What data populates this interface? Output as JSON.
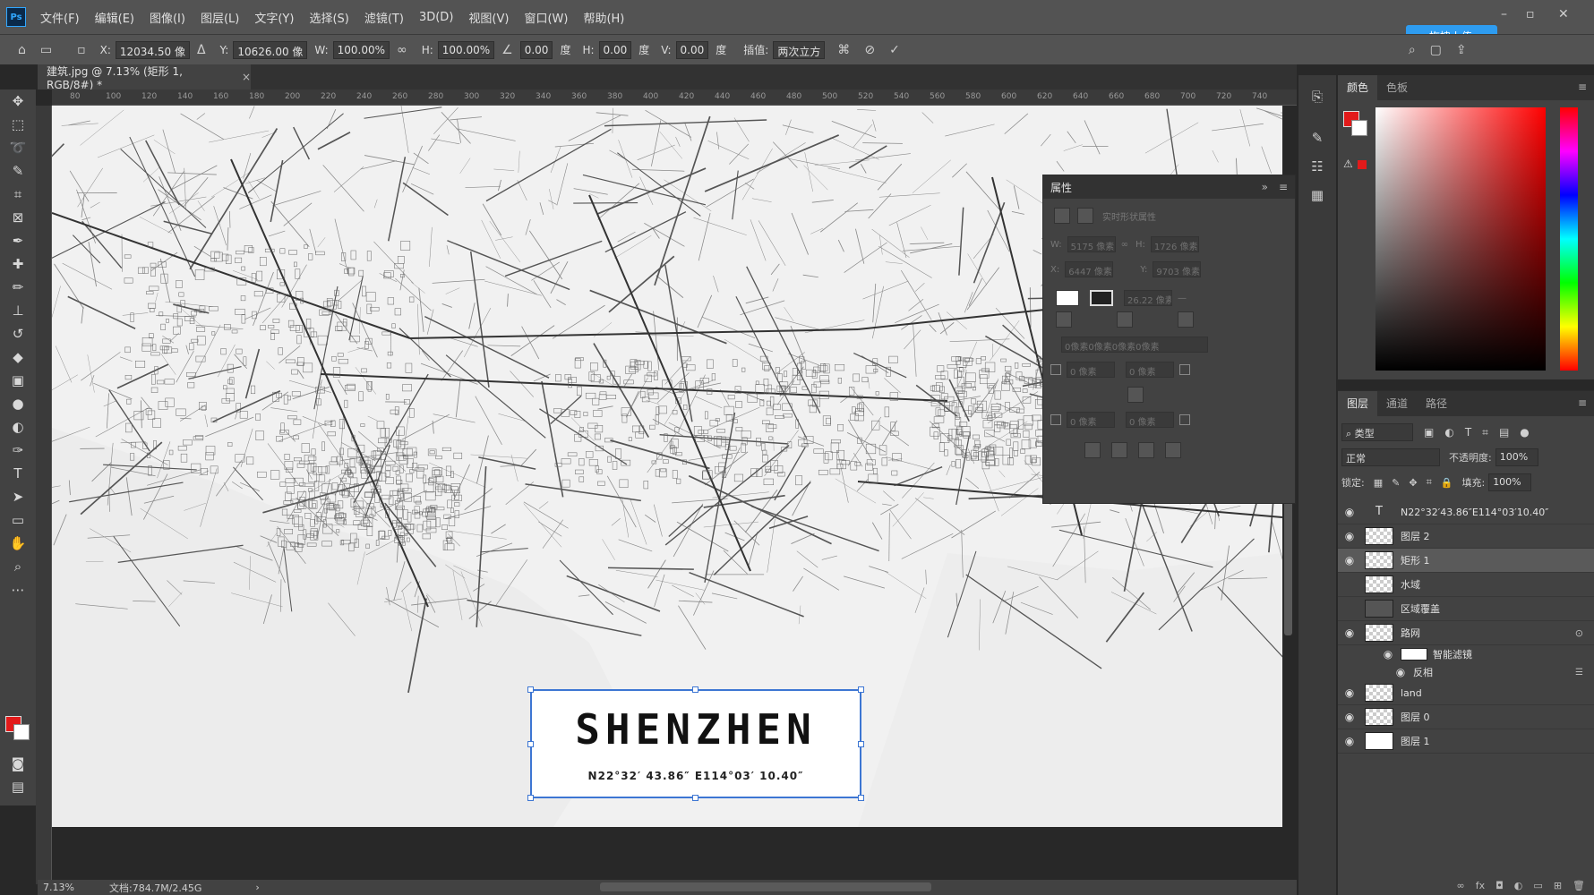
{
  "app": {
    "logo": "Ps",
    "menus": [
      "文件(F)",
      "编辑(E)",
      "图像(I)",
      "图层(L)",
      "文字(Y)",
      "选择(S)",
      "滤镜(T)",
      "3D(D)",
      "视图(V)",
      "窗口(W)",
      "帮助(H)"
    ],
    "upload_label": "拖拽上传"
  },
  "options": {
    "x_label": "X:",
    "x_value": "12034.50 像",
    "y_label": "Y:",
    "y_value": "10626.00 像",
    "w_label": "W:",
    "w_value": "100.00%",
    "h_label": "H:",
    "h_value": "100.00%",
    "angle_value": "0.00",
    "angle_unit": "度",
    "hskew_label": "H:",
    "hskew_value": "0.00",
    "hskew_unit": "度",
    "vskew_label": "V:",
    "vskew_value": "0.00",
    "vskew_unit": "度",
    "interp_label": "插值:",
    "interp_value": "两次立方"
  },
  "document": {
    "tab_title": "建筑.jpg @ 7.13% (矩形 1, RGB/8#) *",
    "zoom": "7.13%",
    "doc_info": "文档:784.7M/2.45G",
    "ruler_ticks": [
      "80",
      "100",
      "120",
      "140",
      "160",
      "180",
      "200",
      "220",
      "240",
      "260",
      "280",
      "300",
      "320",
      "340",
      "360",
      "380",
      "400",
      "420",
      "440",
      "460",
      "480",
      "500",
      "520",
      "540",
      "560",
      "580",
      "600",
      "620",
      "640",
      "660",
      "680",
      "700",
      "720",
      "740"
    ]
  },
  "card": {
    "title": "SHENZHEN",
    "coords": "N22°32′ 43.86″ E114°03′ 10.40″"
  },
  "properties": {
    "title": "属性",
    "section_label": "实时形状属性",
    "w_label": "W:",
    "w_value": "5175 像素",
    "h_label": "H:",
    "h_value": "1726 像素",
    "x_label": "X:",
    "x_value": "6447 像素",
    "y_label": "Y:",
    "y_value": "9703 像素",
    "stroke_value": "26.22 像素",
    "radius_summary": "0像素0像素0像素0像素",
    "corner_tl": "0 像素",
    "corner_tr": "0 像素",
    "corner_bl": "0 像素",
    "corner_br": "0 像素"
  },
  "color_panel": {
    "tabs": [
      "颜色",
      "色板"
    ],
    "fg_color": "#e31a1a",
    "bg_color": "#ffffff"
  },
  "layers_panel": {
    "tabs": [
      "图层",
      "通道",
      "路径"
    ],
    "kind_filter": "类型",
    "blend_mode": "正常",
    "opacity_label": "不透明度:",
    "opacity_value": "100%",
    "lock_label": "锁定:",
    "fill_label": "填充:",
    "fill_value": "100%",
    "layers": [
      {
        "name": "N22°32′43.86″E114°03′10.40″",
        "visible": true,
        "thumb": "text"
      },
      {
        "name": "图层 2",
        "visible": true,
        "thumb": "checker"
      },
      {
        "name": "矩形 1",
        "visible": true,
        "thumb": "checker",
        "selected": true
      },
      {
        "name": "水域",
        "visible": false,
        "thumb": "checker"
      },
      {
        "name": "区域覆盖",
        "visible": false,
        "thumb": "dark"
      },
      {
        "name": "路网",
        "visible": true,
        "thumb": "checker"
      },
      {
        "name": "land",
        "visible": true,
        "thumb": "checker"
      },
      {
        "name": "图层 0",
        "visible": true,
        "thumb": "checker"
      },
      {
        "name": "图层 1",
        "visible": true,
        "thumb": "white"
      }
    ],
    "smart_filters_label": "智能滤镜",
    "smart_filter_item": "反相"
  }
}
